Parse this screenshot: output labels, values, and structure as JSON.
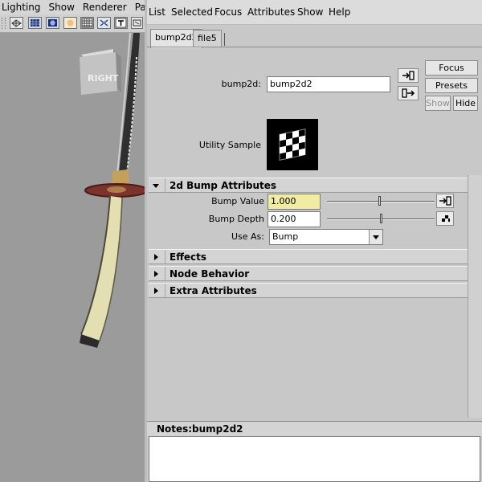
{
  "viewport": {
    "menu": [
      "Lighting",
      "Show",
      "Renderer",
      "Panel"
    ],
    "toolbar_icons": [
      "wireframe-icon",
      "grid-icon",
      "smooth-shade-icon",
      "light-icon",
      "checker-icon",
      "camera-icon",
      "text-icon",
      "isolate-icon"
    ],
    "viewcube_label": "RIGHT"
  },
  "attribute_editor": {
    "menu": [
      "List",
      "Selected",
      "Focus",
      "Attributes",
      "Show",
      "Help"
    ],
    "tabs": [
      {
        "label": "bump2d2",
        "active": true
      },
      {
        "label": "file5",
        "active": false
      }
    ],
    "node_type_label": "bump2d:",
    "node_name": "bump2d2",
    "buttons": {
      "focus": "Focus",
      "presets": "Presets",
      "show": "Show",
      "hide": "Hide"
    },
    "utility_sample_label": "Utility Sample",
    "sections": [
      {
        "title": "2d Bump Attributes",
        "expanded": true
      },
      {
        "title": "Effects",
        "expanded": false
      },
      {
        "title": "Node Behavior",
        "expanded": false
      },
      {
        "title": "Extra Attributes",
        "expanded": false
      }
    ],
    "bump_value": {
      "label": "Bump Value",
      "value": "1.000"
    },
    "bump_depth": {
      "label": "Bump Depth",
      "value": "0.200"
    },
    "use_as": {
      "label": "Use As:",
      "value": "Bump"
    },
    "notes": {
      "label": "Notes:",
      "node": "bump2d2"
    }
  }
}
